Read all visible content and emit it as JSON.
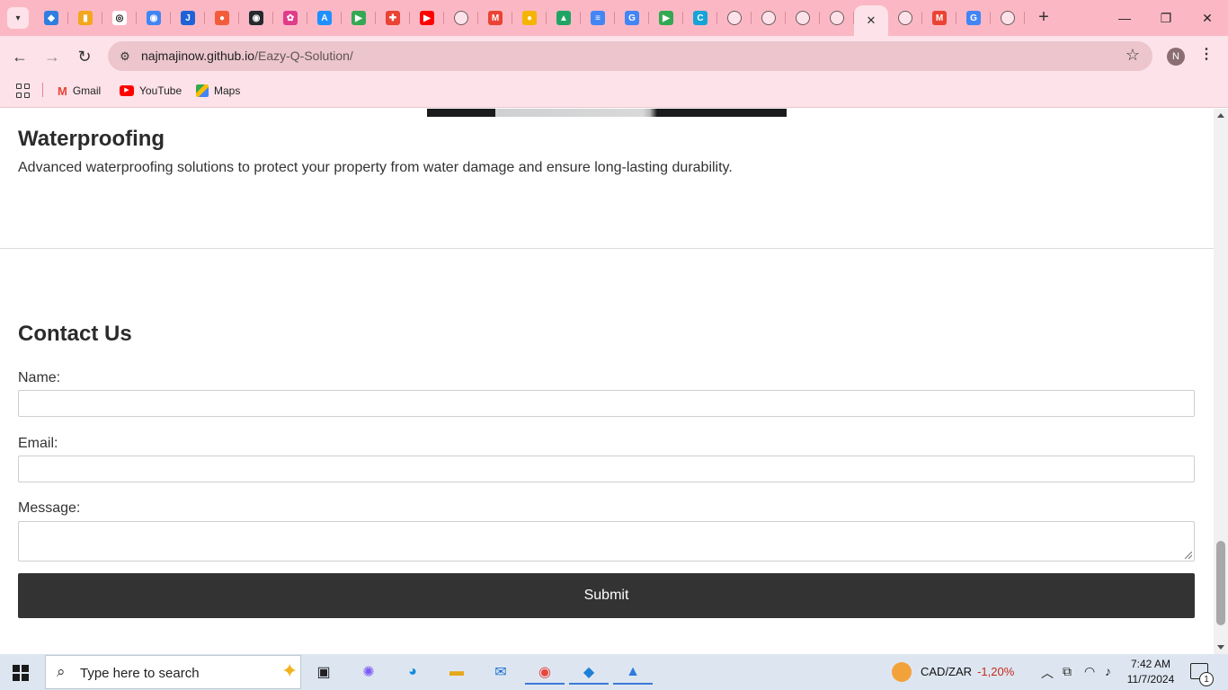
{
  "browser": {
    "tabs": [
      {
        "icon": "vscode-icon",
        "color": "#2f7ee0",
        "glyph": "◆"
      },
      {
        "icon": "analytics-icon",
        "color": "#f4a61d",
        "glyph": "▮"
      },
      {
        "icon": "openai-icon",
        "color": "#ffffff",
        "glyph": "◎"
      },
      {
        "icon": "lens-icon",
        "color": "#4285f4",
        "glyph": "◉"
      },
      {
        "icon": "jira-icon",
        "color": "#1f62d6",
        "glyph": "J"
      },
      {
        "icon": "app-icon",
        "color": "#f25c3b",
        "glyph": "●"
      },
      {
        "icon": "github-icon",
        "color": "#24292e",
        "glyph": "◉"
      },
      {
        "icon": "butterfly-icon",
        "color": "#e03c8a",
        "glyph": "✿"
      },
      {
        "icon": "appstore-icon",
        "color": "#1e90ff",
        "glyph": "A"
      },
      {
        "icon": "play-store-icon",
        "color": "#34a853",
        "glyph": "▶"
      },
      {
        "icon": "play-games-icon",
        "color": "#ea4335",
        "glyph": "✚"
      },
      {
        "icon": "youtube-icon",
        "color": "#ff0000",
        "glyph": "▶"
      },
      {
        "icon": "globe-icon",
        "color": "",
        "glyph": ""
      },
      {
        "icon": "gmail-icon",
        "color": "#ea4335",
        "glyph": "M"
      },
      {
        "icon": "app-icon",
        "color": "#f5b400",
        "glyph": "●"
      },
      {
        "icon": "drive-icon",
        "color": "#1fa463",
        "glyph": "▲"
      },
      {
        "icon": "docs-icon",
        "color": "#4285f4",
        "glyph": "≡"
      },
      {
        "icon": "google-icon",
        "color": "#4285f4",
        "glyph": "G"
      },
      {
        "icon": "play-console-icon",
        "color": "#34a853",
        "glyph": "▶"
      },
      {
        "icon": "canva-icon",
        "color": "#16a3d6",
        "glyph": "C"
      },
      {
        "icon": "globe-icon",
        "color": "",
        "glyph": ""
      },
      {
        "icon": "globe-icon",
        "color": "",
        "glyph": ""
      },
      {
        "icon": "globe-icon",
        "color": "",
        "glyph": ""
      },
      {
        "icon": "globe-icon",
        "color": "",
        "glyph": ""
      },
      {
        "icon": "close-icon",
        "color": "",
        "glyph": "✕",
        "active": true
      },
      {
        "icon": "globe-icon",
        "color": "",
        "glyph": ""
      },
      {
        "icon": "gmail-icon",
        "color": "#ea4335",
        "glyph": "M"
      },
      {
        "icon": "google-icon",
        "color": "#4285f4",
        "glyph": "G"
      },
      {
        "icon": "globe-icon",
        "color": "",
        "glyph": ""
      }
    ],
    "url_host": "najmajinow.github.io",
    "url_path": "/Eazy-Q-Solution/",
    "profile_initial": "N",
    "bookmarks": [
      {
        "label": "Gmail",
        "icon": "gmail-icon"
      },
      {
        "label": "YouTube",
        "icon": "youtube-icon"
      },
      {
        "label": "Maps",
        "icon": "maps-icon"
      }
    ]
  },
  "page": {
    "service_title": "Waterproofing",
    "service_description": "Advanced waterproofing solutions to protect your property from water damage and ensure long-lasting durability.",
    "contact_title": "Contact Us",
    "name_label": "Name:",
    "email_label": "Email:",
    "message_label": "Message:",
    "name_value": "",
    "email_value": "",
    "message_value": "",
    "submit_label": "Submit"
  },
  "taskbar": {
    "search_placeholder": "Type here to search",
    "ticker_symbol": "CAD/ZAR",
    "ticker_change": "-1,20%",
    "time": "7:42 AM",
    "date": "11/7/2024",
    "notification_count": "1"
  },
  "colors": {
    "tabstrip": "#fbb8c4",
    "toolbar": "#fde3e9",
    "submit_bg": "#333333",
    "taskbar": "#dde6f0"
  }
}
